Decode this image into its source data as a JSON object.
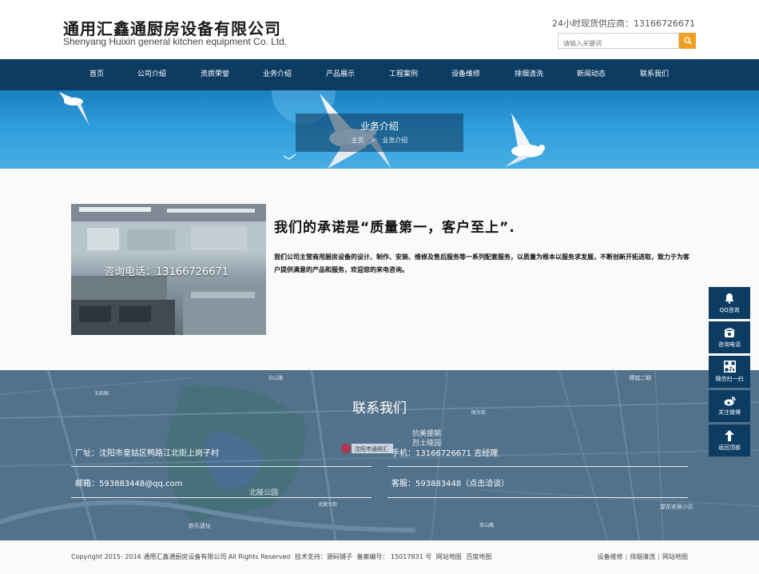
{
  "header": {
    "company_cn": "通用汇鑫通厨房设备有限公司",
    "company_en": "Shenyang Huixin general kitchen equipment Co. Ltd.",
    "hotline_label": "24小时现货供应商：",
    "hotline_number": "13166726671",
    "search_placeholder": "请输入关键词",
    "search_icon": "search-icon"
  },
  "nav": {
    "items": [
      "首页",
      "公司介绍",
      "资质荣誉",
      "业务介绍",
      "产品展示",
      "工程案例",
      "设备维修",
      "排烟清洗",
      "新闻动态",
      "联系我们"
    ]
  },
  "banner": {
    "title": "业务介绍",
    "crumb_home": "主页",
    "crumb_sep": ">",
    "crumb_current": "业务介绍"
  },
  "content": {
    "photo_caption": "咨询电话：13166726671",
    "headline": "我们的承诺是“质量第一，客户至上”.",
    "body": "我们公司主营商用厨房设备的设计、制作、安装、维修及售后服务等一系列配套服务，以质量为根本以服务求发展，不断创新开拓进取，致力于为客户提供满意的产品和服务，欢迎您的来电咨询。"
  },
  "contact": {
    "title": "联系我们",
    "address": "厂址：沈阳市皇姑区鸭路江北街上岗子村",
    "phone": "手机：13166726671 吉经理",
    "email": "邮箱：593883448@qq.com",
    "service": "客服：593883448（点击洽谈）",
    "map_labels": [
      "北陵公园",
      "抗美援朝",
      "烈士陵园",
      "沈阳市通用汇",
      "新乐遗址",
      "望花安居小区",
      "博城二期",
      "白山路",
      "五彩阁",
      "陵东街",
      "北陵大街",
      "崇山路"
    ]
  },
  "footer": {
    "copyright": "Copyright 2015- 2016 通用汇鑫通厨房设备有限公司 All Rights Reserved",
    "tech": "技术支持：源码铺子",
    "icp": "备案编号： 15017831 号",
    "sitemap": "网站地图",
    "baidu": "百度地图",
    "links": [
      "设备维修",
      "排烟清洗",
      "网站地图"
    ]
  },
  "sidebar": {
    "items": [
      {
        "label": "QQ咨询",
        "icon": "bell-icon"
      },
      {
        "label": "咨询电话",
        "icon": "phone-icon"
      },
      {
        "label": "微信扫一扫",
        "icon": "qrcode-icon"
      },
      {
        "label": "关注微博",
        "icon": "weibo-icon"
      },
      {
        "label": "返回顶部",
        "icon": "arrow-up-icon"
      }
    ]
  },
  "colors": {
    "nav_bg": "#0d3c63",
    "search_button": "#f0a020",
    "contact_overlay": "#4f6f87",
    "banner_sky": "#2f9ddc"
  }
}
